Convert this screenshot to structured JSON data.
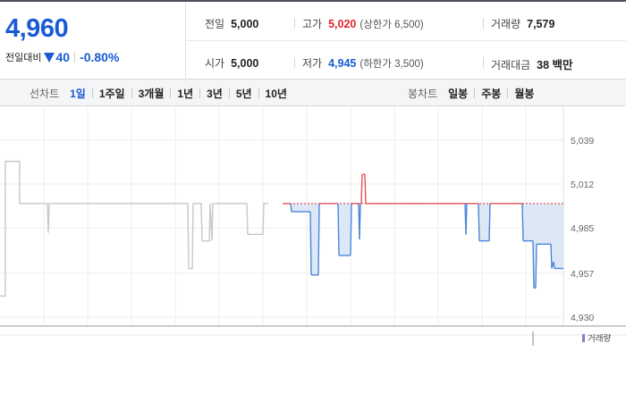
{
  "summary": {
    "current_price": "4,960",
    "change_label": "전일대비",
    "change_amount": "40",
    "change_percent": "-0.80%",
    "prev_close": {
      "label": "전일",
      "value": "5,000"
    },
    "high": {
      "label": "고가",
      "value": "5,020",
      "sub": "(상한가 6,500)"
    },
    "volume": {
      "label": "거래량",
      "value": "7,579"
    },
    "open": {
      "label": "시가",
      "value": "5,000"
    },
    "low": {
      "label": "저가",
      "value": "4,945",
      "sub": "(하한가 3,500)"
    },
    "trade_value": {
      "label": "거래대금",
      "value": "38 백만"
    }
  },
  "tabs": {
    "line_title": "선차트",
    "line_tabs": [
      "1일",
      "1주일",
      "3개월",
      "1년",
      "3년",
      "5년",
      "10년"
    ],
    "active_line_tab": 0,
    "candle_title": "봉차트",
    "candle_tabs": [
      "일봉",
      "주봉",
      "월봉"
    ]
  },
  "colors": {
    "accent_blue": "#1a5bd4",
    "up_red": "#e5242c",
    "prior_line": "#c8c8c8",
    "above_line": "#e8525a",
    "below_line": "#4a86d8",
    "below_fill": "#dde8f7",
    "reference": "#e5242c"
  },
  "chart_data": {
    "type": "line",
    "reference_value": 5000,
    "ylim": [
      4930,
      5039
    ],
    "yticks": [
      "5,039",
      "5,012",
      "4,985",
      "4,957",
      "4,930"
    ],
    "ytick_values": [
      5039,
      5012,
      4985,
      4957,
      4930
    ],
    "prior_series": [
      [
        0,
        4943
      ],
      [
        6,
        4943
      ],
      [
        6,
        5026
      ],
      [
        22,
        5026
      ],
      [
        22,
        5000
      ],
      [
        53,
        5000
      ],
      [
        54,
        4982
      ],
      [
        55,
        5000
      ],
      [
        210,
        5000
      ],
      [
        211,
        4960
      ],
      [
        215,
        4960
      ],
      [
        216,
        5000
      ],
      [
        225,
        5000
      ],
      [
        226,
        4977
      ],
      [
        234,
        4977
      ],
      [
        235,
        5000
      ],
      [
        237,
        4977
      ],
      [
        238,
        5000
      ],
      [
        276,
        5000
      ],
      [
        277,
        4981
      ],
      [
        294,
        4981
      ],
      [
        295,
        5000
      ],
      [
        300,
        5000
      ]
    ],
    "today_series": [
      [
        316,
        5000
      ],
      [
        325,
        5000
      ],
      [
        326,
        4995
      ],
      [
        347,
        4995
      ],
      [
        348,
        4956
      ],
      [
        356,
        4956
      ],
      [
        357,
        5000
      ],
      [
        378,
        5000
      ],
      [
        379,
        4968
      ],
      [
        392,
        4968
      ],
      [
        393,
        5000
      ],
      [
        401,
        5000
      ],
      [
        402,
        4978
      ],
      [
        403,
        5000
      ],
      [
        404,
        5000
      ],
      [
        405,
        5018
      ],
      [
        408,
        5018
      ],
      [
        409,
        5000
      ],
      [
        520,
        5000
      ],
      [
        521,
        4981
      ],
      [
        522,
        5000
      ],
      [
        535,
        5000
      ],
      [
        536,
        4977
      ],
      [
        547,
        4977
      ],
      [
        548,
        5000
      ],
      [
        584,
        5000
      ],
      [
        585,
        4977
      ],
      [
        596,
        4977
      ],
      [
        597,
        4948
      ],
      [
        599,
        4948
      ],
      [
        600,
        4975
      ],
      [
        612,
        4975
      ],
      [
        616,
        4975
      ],
      [
        617,
        4960
      ],
      [
        619,
        4964
      ],
      [
        620,
        4960
      ],
      [
        630,
        4960
      ]
    ],
    "x_domain": [
      0,
      630
    ],
    "legend": "거래량"
  }
}
